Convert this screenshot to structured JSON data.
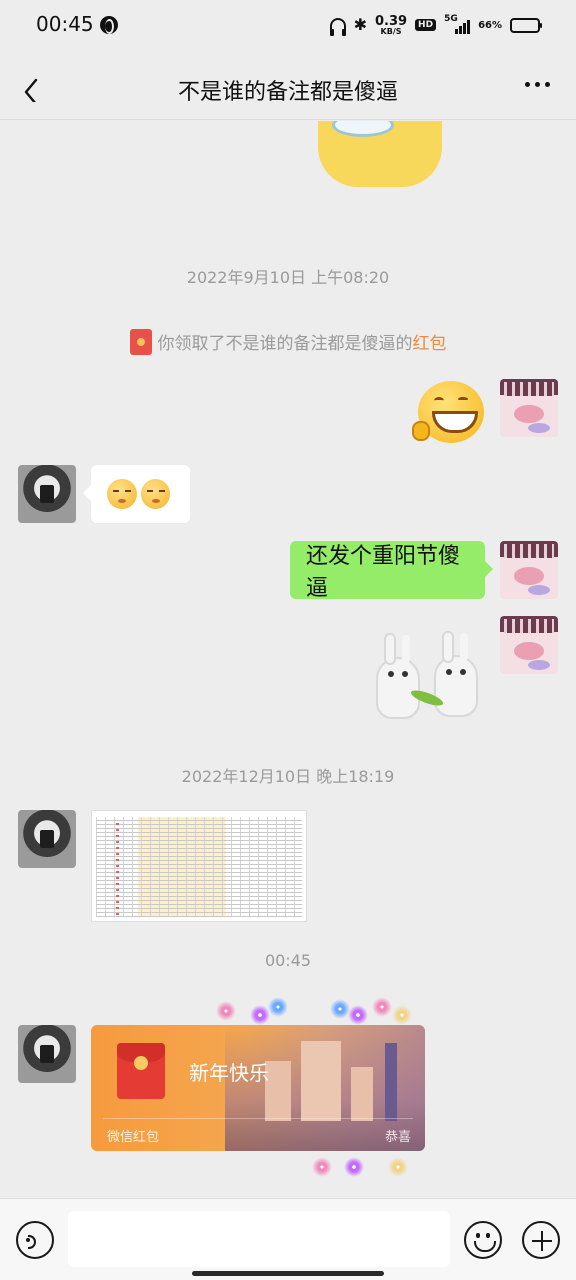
{
  "status": {
    "time": "00:45",
    "speed_value": "0.39",
    "speed_unit": "KB/S",
    "hd": "HD",
    "network": "5G",
    "battery_pct": "66%",
    "battery_level": 0.66,
    "battery_color": "#ef5f6b"
  },
  "nav": {
    "title": "不是谁的备注都是傻逼"
  },
  "chat": {
    "timestamps": [
      "2022年9月10日 上午08:20",
      "2022年12月10日 晚上18:19",
      "00:45"
    ],
    "system_prefix": "你领取了不是谁的备注都是傻逼的",
    "system_link": "红包",
    "message_right_text": "还发个重阳节傻逼",
    "redpacket": {
      "title": "新年快乐",
      "footer_left": "微信红包",
      "footer_right": "恭喜"
    }
  },
  "icons": {
    "back": "chevron-left-icon",
    "more": "ellipsis-icon",
    "voice": "voice-icon",
    "emoji": "smiley-icon",
    "plus": "plus-icon"
  },
  "colors": {
    "bubble_right": "#95ec69",
    "bubble_left": "#ffffff",
    "redpacket": "#f79a3e",
    "link": "#ee8a3b",
    "background": "#ededed"
  }
}
